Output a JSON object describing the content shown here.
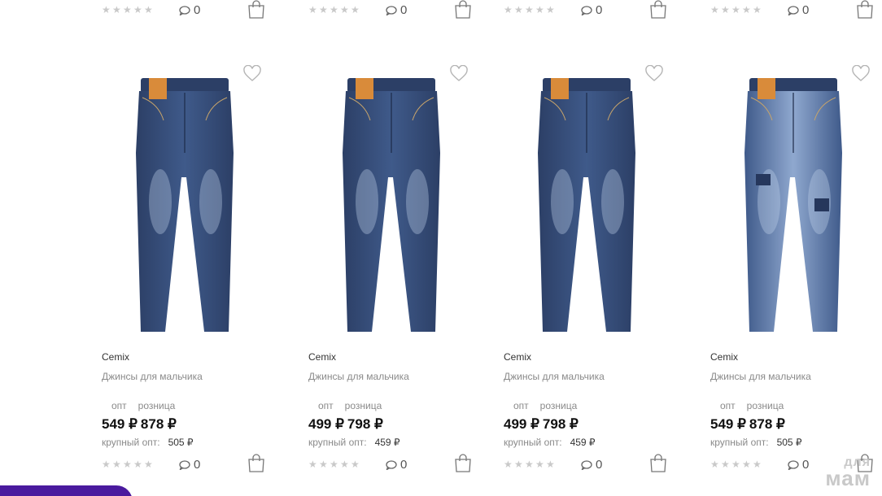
{
  "products": [
    {
      "brand": "Cemix",
      "name": "Джинсы для мальчика",
      "label_opt": "опт",
      "label_retail": "розница",
      "price_opt": "549 ₽",
      "price_retail": "878 ₽",
      "bulk_label": "крупный опт:",
      "bulk_price": "505 ₽",
      "rating": 0,
      "comments": "0",
      "top_comments": "0",
      "variant": "a"
    },
    {
      "brand": "Cemix",
      "name": "Джинсы для мальчика",
      "label_opt": "опт",
      "label_retail": "розница",
      "price_opt": "499 ₽",
      "price_retail": "798 ₽",
      "bulk_label": "крупный опт:",
      "bulk_price": "459 ₽",
      "rating": 0,
      "comments": "0",
      "top_comments": "0",
      "variant": "a"
    },
    {
      "brand": "Cemix",
      "name": "Джинсы для мальчика",
      "label_opt": "опт",
      "label_retail": "розница",
      "price_opt": "499 ₽",
      "price_retail": "798 ₽",
      "bulk_label": "крупный опт:",
      "bulk_price": "459 ₽",
      "rating": 0,
      "comments": "0",
      "top_comments": "0",
      "variant": "a"
    },
    {
      "brand": "Cemix",
      "name": "Джинсы для мальчика",
      "label_opt": "опт",
      "label_retail": "розница",
      "price_opt": "549 ₽",
      "price_retail": "878 ₽",
      "bulk_label": "крупный опт:",
      "bulk_price": "505 ₽",
      "rating": 0,
      "comments": "0",
      "top_comments": "0",
      "variant": "b"
    }
  ],
  "icons": {
    "star": "star-icon",
    "comment": "comment-icon",
    "bag": "shopping-bag-icon",
    "heart": "heart-icon"
  },
  "colors": {
    "denim_dark": "#2c3f66",
    "denim_mid": "#3f5a8a",
    "denim_light": "#8fa8cf",
    "promo": "#4a1a9e",
    "muted_text": "#8a8a8a",
    "star": "#c9c9c9"
  },
  "watermark": {
    "line1": "для",
    "line2": "мам"
  }
}
